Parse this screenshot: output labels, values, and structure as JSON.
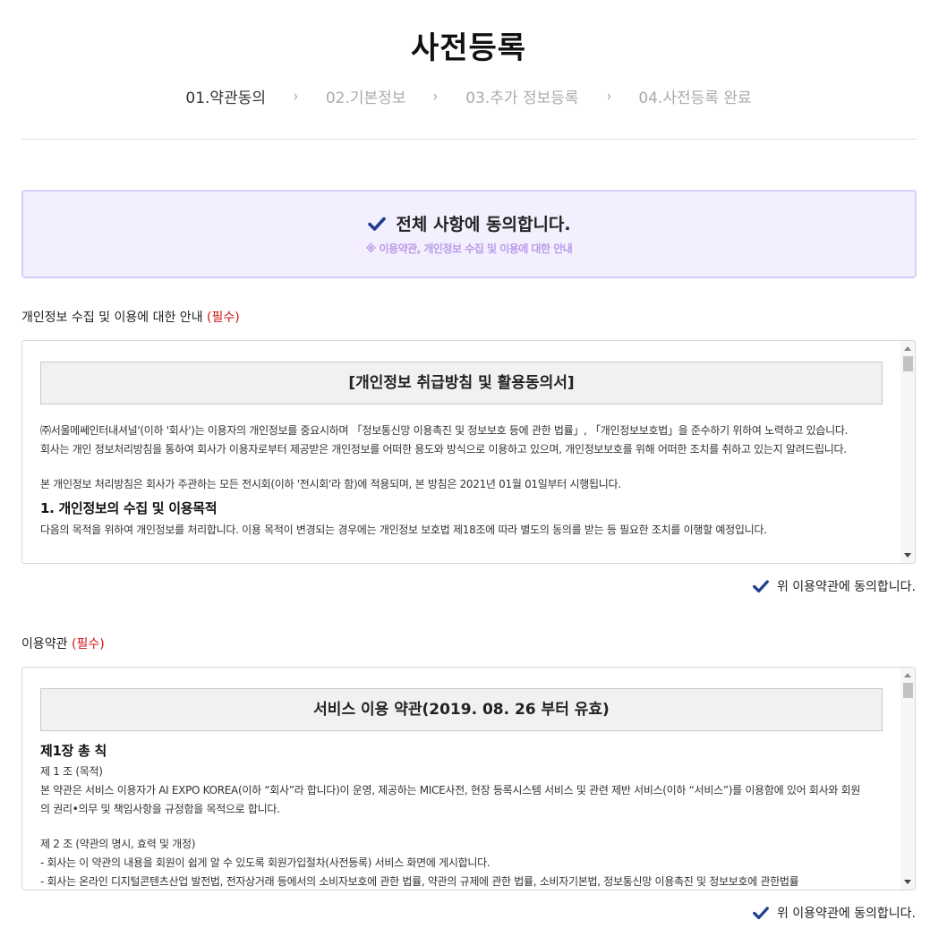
{
  "page": {
    "title": "사전등록"
  },
  "steps": [
    {
      "label": "01.약관동의",
      "active": true
    },
    {
      "label": "02.기본정보",
      "active": false
    },
    {
      "label": "03.추가 정보등록",
      "active": false
    },
    {
      "label": "04.사전등록 완료",
      "active": false
    }
  ],
  "step_separator": "›",
  "agree_all": {
    "checked": true,
    "label": "전체 사항에 동의합니다.",
    "note": "※ 이용약관, 개인정보 수집 및 이용에 대한 안내"
  },
  "privacy": {
    "title": "개인정보 수집 및 이용에 대한 안내",
    "required": "(필수)",
    "box_title": "[개인정보 취급방침 및 활용동의서]",
    "para1_line1": "㈜서울메쎄인터내셔널'(이하 '회사')는 이용자의 개인정보를 중요시하며 「정보통신망 이용촉진 및 정보보호 등에 관한 법률」, 「개인정보보호법」을 준수하기 위하여 노력하고 있습니다.",
    "para1_line2": "회사는 개인 정보처리방침을 통하여 회사가 이용자로부터 제공받은 개인정보를 어떠한 용도와 방식으로 이용하고 있으며, 개인정보보호를 위해 어떠한 조치를 취하고 있는지 알려드립니다.",
    "para2": "본 개인정보 처리방침은 회사가 주관하는 모든 전시회(이하 '전시회'라 함)에 적용되며, 본 방침은 2021년 01월 01일부터 시행됩니다.",
    "heading1": "1. 개인정보의 수집 및 이용목적",
    "para3": "다음의 목적을 위하여 개인정보를 처리합니다. 이용 목적이 변경되는 경우에는 개인정보 보호법 제18조에 따라 별도의 동의를 받는 등 필요한 조치를 이행할 예정입니다.",
    "agree_label": "위 이용약관에 동의합니다.",
    "agree_checked": true
  },
  "terms": {
    "title": "이용약관",
    "required": "(필수)",
    "box_title": "서비스 이용 약관(2019. 08. 26 부터 유효)",
    "chapter": "제1장 총 칙",
    "article1_title": "제 1 조 (목적)",
    "article1_line1": "본 약관은 서비스 이용자가 AI EXPO KOREA(이하 “회사”라 합니다)이 운영, 제공하는 MICE사전, 현장 등록시스템 서비스 및 관련 제반 서비스(이하 “서비스”)를 이용함에 있어 회사와 회원",
    "article1_line2": "의 권리•의무 및 책임사항을 규정함을 목적으로 합니다.",
    "article2_title": "제 2 조 (약관의 명시, 효력 및 개정)",
    "article2_item1": " - 회사는 이 약관의 내용을 회원이 쉽게 알 수 있도록 회원가입절차(사전등록) 서비스 화면에 게시합니다.",
    "article2_item2": " - 회사는 온라인 디지털콘텐츠산업 발전법, 전자상거래 등에서의 소비자보호에 관한 법률, 약관의 규제에 관한 법률, 소비자기본법, 정보통신망 이용촉진 및 정보보호에 관한법률",
    "agree_label": "위 이용약관에 동의합니다.",
    "agree_checked": true
  },
  "colors": {
    "checkbox": "#1f3f8f",
    "required": "#d21414",
    "agree_all_bg": "#f3efff",
    "agree_all_border": "#d8cdf8",
    "agree_all_note": "#b99be6"
  }
}
